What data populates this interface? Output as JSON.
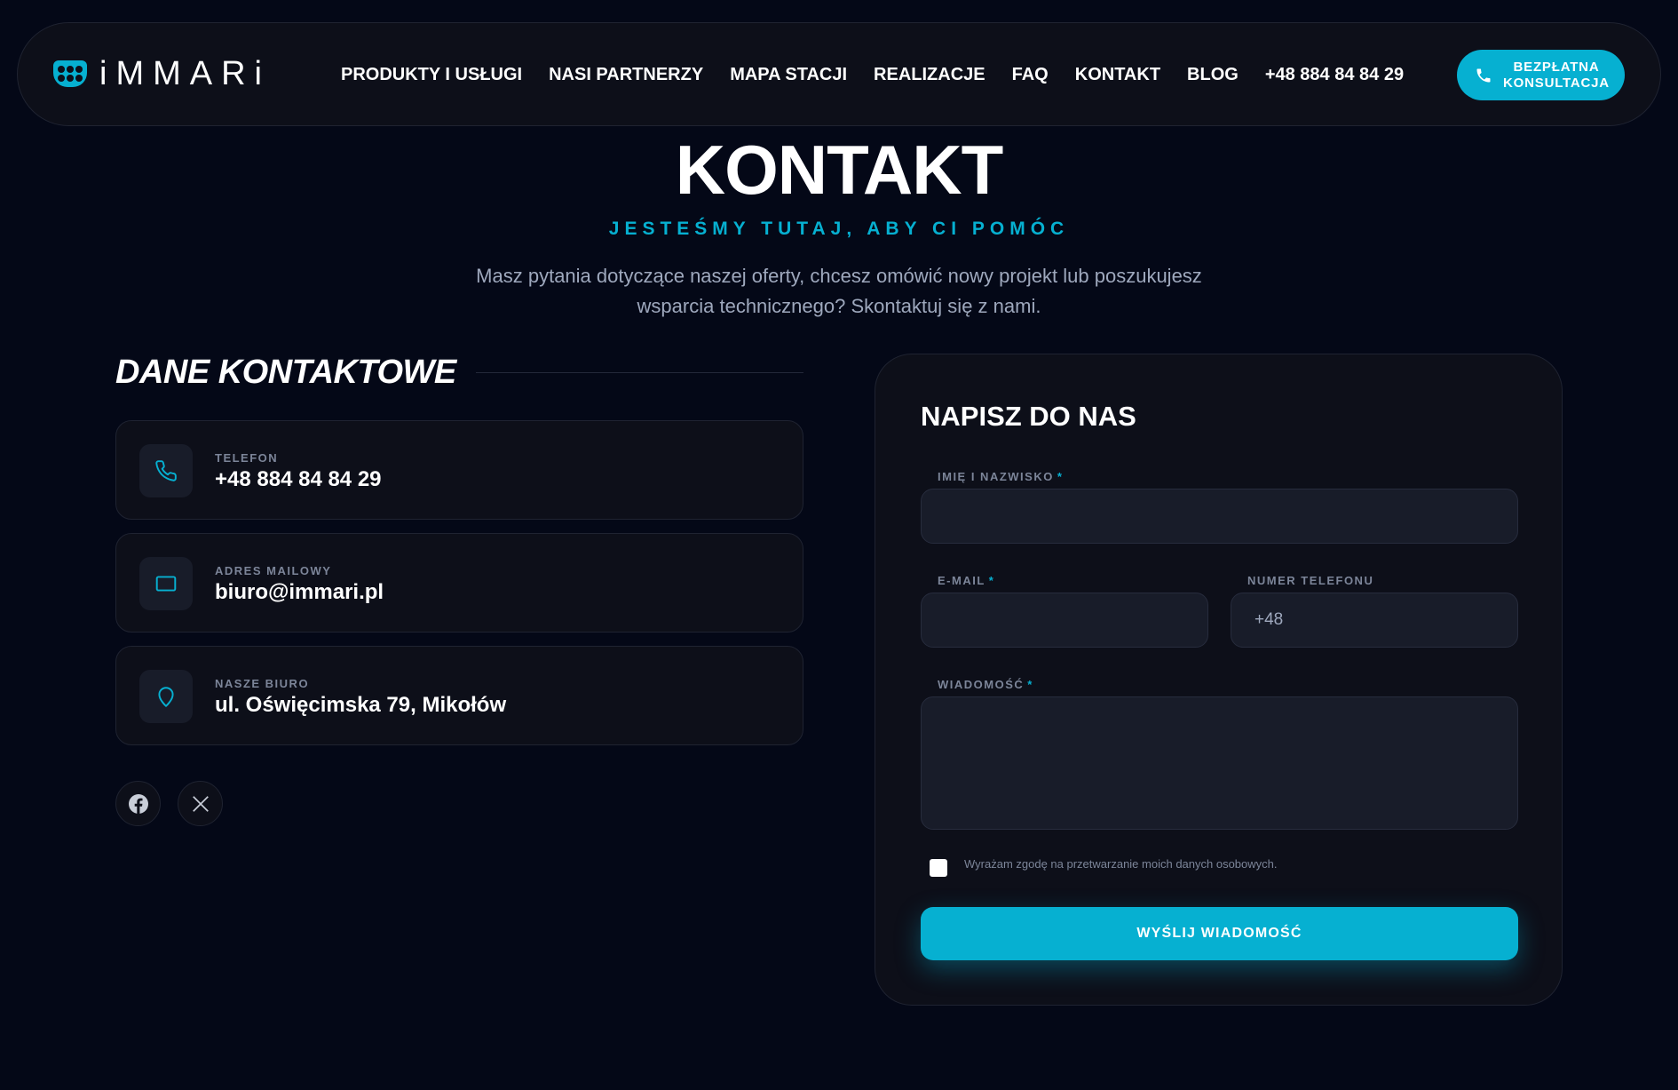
{
  "brand": {
    "name": "iMMARi",
    "logo_icon": "plug-socket-icon",
    "accent_color": "#06b0d1"
  },
  "nav": {
    "links": [
      "PRODUKTY I USŁUGI",
      "NASI PARTNERZY",
      "MAPA STACJI",
      "REALIZACJE",
      "FAQ",
      "KONTAKT",
      "BLOG",
      "+48 884 84 84 29"
    ],
    "cta_line1": "BEZPŁATNA",
    "cta_line2": "KONSULTACJA",
    "cta_icon": "phone-icon"
  },
  "hero": {
    "title": "KONTAKT",
    "subtitle": "JESTEŚMY TUTAJ, ABY CI POMÓC",
    "description": "Masz pytania dotyczące naszej oferty, chcesz omówić nowy projekt lub poszukujesz wsparcia technicznego? Skontaktuj się z nami."
  },
  "contact": {
    "heading": "DANE KONTAKTOWE",
    "items": [
      {
        "icon": "phone-icon",
        "label": "TELEFON",
        "value": "+48 884 84 84 29"
      },
      {
        "icon": "mail-icon",
        "label": "ADRES MAILOWY",
        "value": "biuro@immari.pl"
      },
      {
        "icon": "map-pin-icon",
        "label": "NASZE BIURO",
        "value": "ul. Oświęcimska 79, Mikołów"
      }
    ],
    "social": [
      "facebook-icon",
      "x-icon"
    ]
  },
  "form": {
    "title": "NAPISZ DO NAS",
    "name_label": "IMIĘ I NAZWISKO",
    "email_label": "E-MAIL",
    "phone_label": "NUMER TELEFONU",
    "phone_placeholder": "+48",
    "message_label": "WIADOMOŚĆ",
    "required_mark": "*",
    "consent": "Wyrażam zgodę na przetwarzanie moich danych osobowych.",
    "submit": "WYŚLIJ WIADOMOŚĆ"
  }
}
